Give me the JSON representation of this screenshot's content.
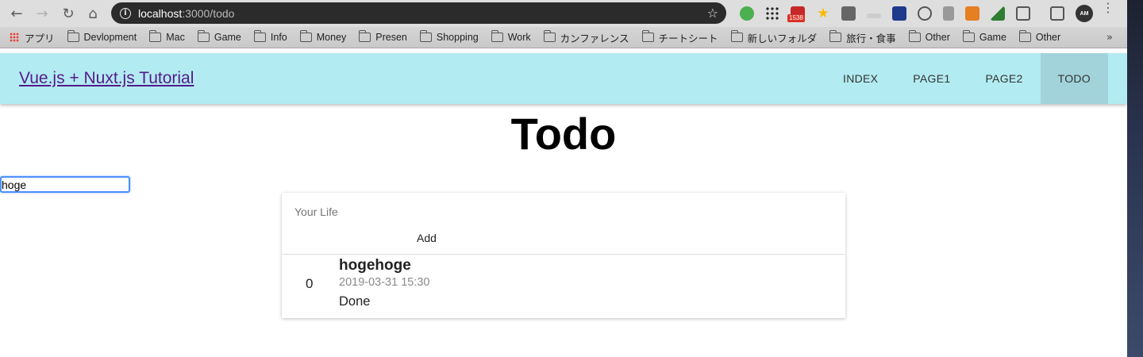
{
  "browser": {
    "url_host": "localhost",
    "url_path": ":3000/todo",
    "mail_badge": "1538",
    "profile_label": "AM",
    "bookmarks": [
      {
        "label": "アプリ",
        "icon": "apps-icon"
      },
      {
        "label": "Devlopment",
        "icon": "folder-icon"
      },
      {
        "label": "Mac",
        "icon": "folder-icon"
      },
      {
        "label": "Game",
        "icon": "folder-icon"
      },
      {
        "label": "Info",
        "icon": "folder-icon"
      },
      {
        "label": "Money",
        "icon": "folder-icon"
      },
      {
        "label": "Presen",
        "icon": "folder-icon"
      },
      {
        "label": "Shopping",
        "icon": "folder-icon"
      },
      {
        "label": "Work",
        "icon": "folder-icon"
      },
      {
        "label": "カンファレンス",
        "icon": "folder-icon"
      },
      {
        "label": "チートシート",
        "icon": "folder-icon"
      },
      {
        "label": "新しいフォルダ",
        "icon": "folder-icon"
      },
      {
        "label": "旅行・食事",
        "icon": "folder-icon"
      },
      {
        "label": "Other",
        "icon": "folder-icon"
      },
      {
        "label": "Game",
        "icon": "folder-icon"
      },
      {
        "label": "Other",
        "icon": "folder-icon"
      }
    ],
    "bookmarks_more": "»"
  },
  "header": {
    "title": "Vue.js + Nuxt.js Tutorial",
    "nav": [
      {
        "label": "INDEX",
        "active": false
      },
      {
        "label": "PAGE1",
        "active": false
      },
      {
        "label": "PAGE2",
        "active": false
      },
      {
        "label": "TODO",
        "active": true
      }
    ],
    "background": "#b2ebf2"
  },
  "main": {
    "title": "Todo",
    "input_value": "hoge",
    "card": {
      "subheader": "Your Life",
      "add_label": "Add",
      "todos": [
        {
          "index": "0",
          "name": "hogehoge",
          "date": "2019-03-31 15:30",
          "status": "Done"
        }
      ]
    }
  }
}
